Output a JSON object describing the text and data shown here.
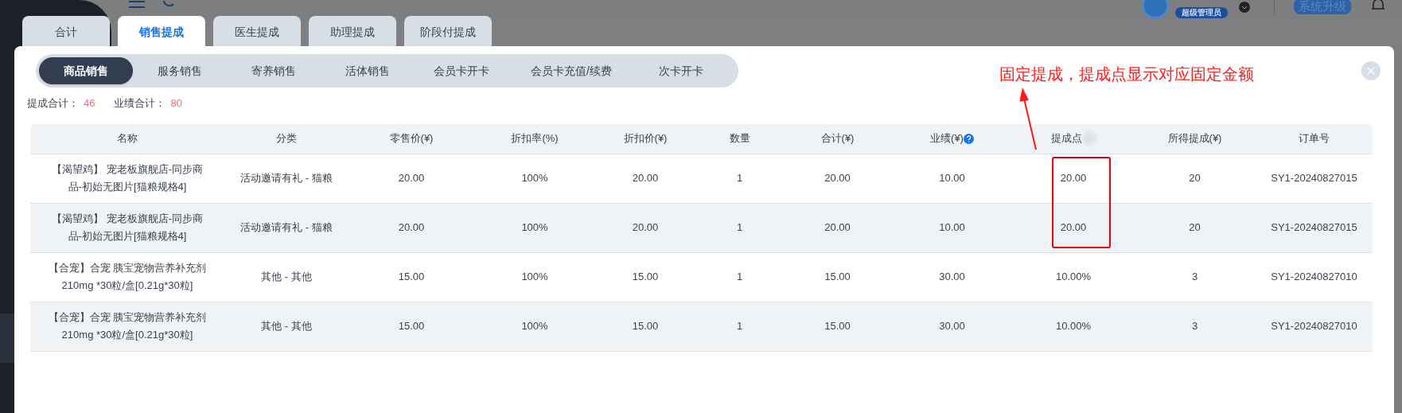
{
  "header": {
    "role_badge": "超级管理员",
    "upgrade_button": "系统升级"
  },
  "tabs": [
    {
      "label": "合计",
      "selected": false
    },
    {
      "label": "销售提成",
      "selected": true
    },
    {
      "label": "医生提成",
      "selected": false
    },
    {
      "label": "助理提成",
      "selected": false
    },
    {
      "label": "阶段付提成",
      "selected": false
    }
  ],
  "sub_tabs": [
    {
      "label": "商品销售",
      "selected": true
    },
    {
      "label": "服务销售",
      "selected": false
    },
    {
      "label": "寄养销售",
      "selected": false
    },
    {
      "label": "活体销售",
      "selected": false
    },
    {
      "label": "会员卡开卡",
      "selected": false
    },
    {
      "label": "会员卡充值/续费",
      "selected": false
    },
    {
      "label": "次卡开卡",
      "selected": false
    }
  ],
  "summary": [
    {
      "label": "提成合计：",
      "value": "46"
    },
    {
      "label": "业绩合计：",
      "value": "80"
    }
  ],
  "annotation": "固定提成，提成点显示对应固定金额",
  "table": {
    "columns": [
      {
        "label": "名称"
      },
      {
        "label": "分类"
      },
      {
        "label": "零售价(¥)"
      },
      {
        "label": "折扣率(%)"
      },
      {
        "label": "折扣价(¥)"
      },
      {
        "label": "数量"
      },
      {
        "label": "合计(¥)"
      },
      {
        "label": "业绩(¥)",
        "help": true
      },
      {
        "label": "提成点",
        "blurred": true
      },
      {
        "label": "所得提成(¥)"
      },
      {
        "label": "订单号"
      }
    ],
    "rows": [
      {
        "cells": [
          "【渴望鸡】 宠老板旗舰店-同步商品-初始无图片[猫粮规格4]",
          "活动邀请有礼 - 猫粮",
          "20.00",
          "100%",
          "20.00",
          "1",
          "20.00",
          "10.00",
          "20.00",
          "20",
          "SY1-20240827015"
        ],
        "highlighted": true
      },
      {
        "cells": [
          "【渴望鸡】 宠老板旗舰店-同步商品-初始无图片[猫粮规格4]",
          "活动邀请有礼 - 猫粮",
          "20.00",
          "100%",
          "20.00",
          "1",
          "20.00",
          "10.00",
          "20.00",
          "20",
          "SY1-20240827015"
        ],
        "highlighted": true
      },
      {
        "cells": [
          "【合宠】合宠 胰宝宠物营养补充剂210mg *30粒/盒[0.21g*30粒]",
          "其他 - 其他",
          "15.00",
          "100%",
          "15.00",
          "1",
          "15.00",
          "30.00",
          "10.00%",
          "3",
          "SY1-20240827010"
        ],
        "highlighted": false
      },
      {
        "cells": [
          "【合宠】合宠 胰宝宠物营养补充剂210mg *30粒/盒[0.21g*30粒]",
          "其他 - 其他",
          "15.00",
          "100%",
          "15.00",
          "1",
          "15.00",
          "30.00",
          "10.00%",
          "3",
          "SY1-20240827010"
        ],
        "highlighted": false
      }
    ]
  }
}
